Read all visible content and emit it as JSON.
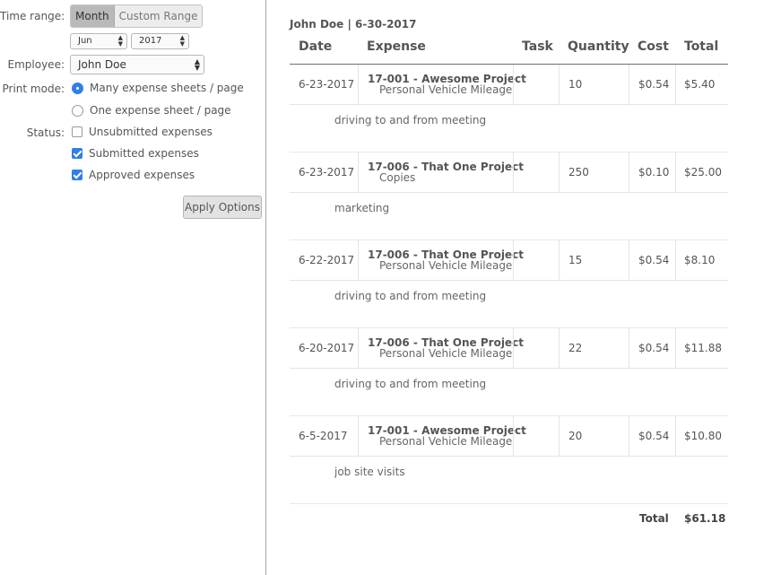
{
  "options": {
    "time_range_label": "Time range:",
    "time_range_tabs": [
      "Month",
      "Custom Range"
    ],
    "month_value": "Jun",
    "year_value": "2017",
    "employee_label": "Employee:",
    "employee_value": "John Doe",
    "print_mode_label": "Print mode:",
    "print_modes": [
      "Many expense sheets / page",
      "One expense sheet / page"
    ],
    "status_label": "Status:",
    "statuses": [
      "Unsubmitted expenses",
      "Submitted expenses",
      "Approved expenses"
    ],
    "apply_label": "Apply Options"
  },
  "report": {
    "title": "John Doe | 6-30-2017",
    "columns": [
      "Date",
      "Expense",
      "Task",
      "Quantity",
      "Cost",
      "Total"
    ],
    "rows": [
      {
        "date": "6-23-2017",
        "project": "17-001 - Awesome Project",
        "category": "Personal Vehicle Mileage",
        "task": "",
        "quantity": "10",
        "cost": "$0.54",
        "total": "$5.40",
        "note": "driving to and from meeting"
      },
      {
        "date": "6-23-2017",
        "project": "17-006 - That One Project",
        "category": "Copies",
        "task": "",
        "quantity": "250",
        "cost": "$0.10",
        "total": "$25.00",
        "note": "marketing"
      },
      {
        "date": "6-22-2017",
        "project": "17-006 - That One Project",
        "category": "Personal Vehicle Mileage",
        "task": "",
        "quantity": "15",
        "cost": "$0.54",
        "total": "$8.10",
        "note": "driving to and from meeting"
      },
      {
        "date": "6-20-2017",
        "project": "17-006 - That One Project",
        "category": "Personal Vehicle Mileage",
        "task": "",
        "quantity": "22",
        "cost": "$0.54",
        "total": "$11.88",
        "note": "driving to and from meeting"
      },
      {
        "date": "6-5-2017",
        "project": "17-001 - Awesome Project",
        "category": "Personal Vehicle Mileage",
        "task": "",
        "quantity": "20",
        "cost": "$0.54",
        "total": "$10.80",
        "note": "job site visits"
      }
    ],
    "total_label": "Total",
    "total_value": "$61.18"
  }
}
